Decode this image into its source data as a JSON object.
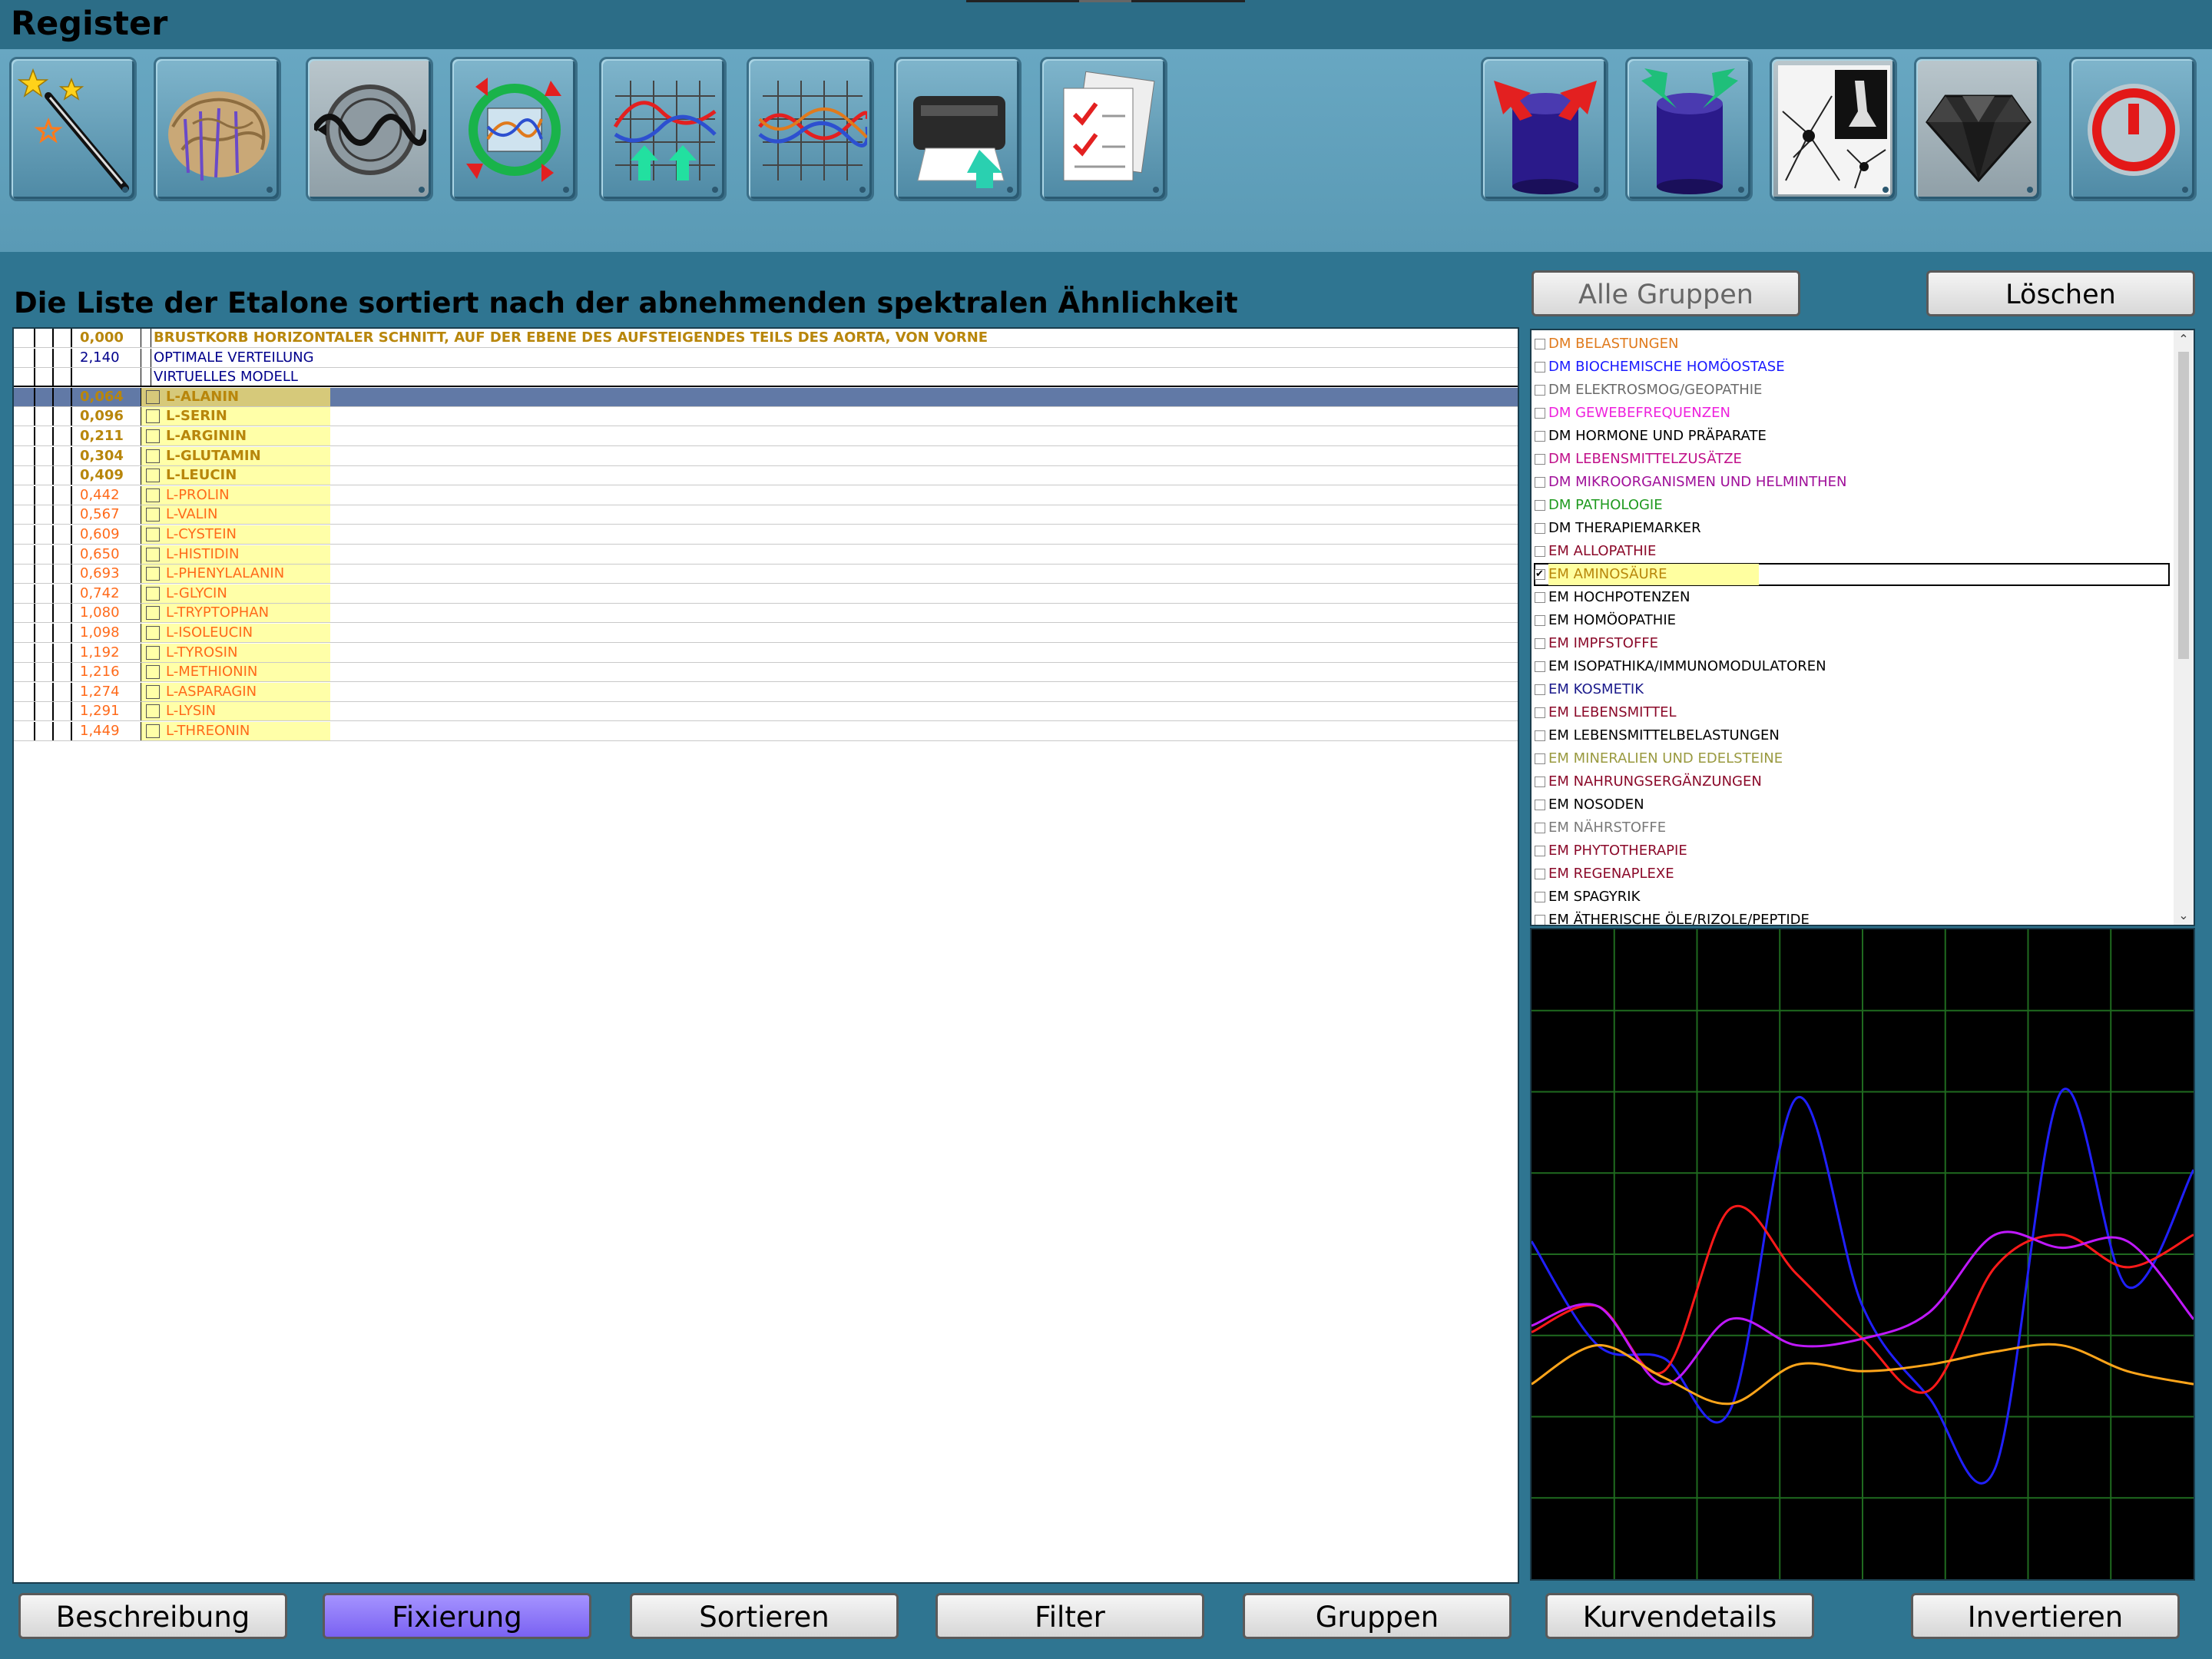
{
  "window": {
    "title": "Register"
  },
  "toolbar": {
    "left_buttons": [
      {
        "name": "magic-wand",
        "icon": "magic-wand-icon"
      },
      {
        "name": "brain",
        "icon": "brain-icon"
      },
      {
        "name": "wave-scan",
        "icon": "wave-scan-icon"
      },
      {
        "name": "cycle-compare",
        "icon": "cycle-compare-icon"
      },
      {
        "name": "graph-arrows",
        "icon": "graph-up-arrows-icon"
      },
      {
        "name": "multi-curve",
        "icon": "multi-curve-icon"
      },
      {
        "name": "printer",
        "icon": "printer-icon"
      },
      {
        "name": "checklist",
        "icon": "checklist-icon"
      }
    ],
    "right_buttons": [
      {
        "name": "bucket-in",
        "icon": "bucket-red-arrows-icon"
      },
      {
        "name": "bucket-out",
        "icon": "bucket-green-arrows-icon"
      },
      {
        "name": "microscope",
        "icon": "microscope-icon"
      },
      {
        "name": "gem",
        "icon": "gem-icon"
      },
      {
        "name": "power",
        "icon": "power-icon"
      }
    ]
  },
  "list": {
    "heading": "Die Liste der Etalone sortiert nach der abnehmenden spektralen Ähnlichkeit",
    "header_rows": [
      {
        "value": "0,000",
        "name": "BRUSTKORB HORIZONTALER SCHNITT, AUF DER EBENE DES AUFSTEIGENDES TEILS DES AORTA, VON VORNE"
      },
      {
        "value": "2,140",
        "name": "OPTIMALE VERTEILUNG"
      },
      {
        "value": "",
        "name": "VIRTUELLES MODELL"
      }
    ],
    "rows": [
      {
        "value": "0,064",
        "name": "L-ALANIN"
      },
      {
        "value": "0,096",
        "name": "L-SERIN"
      },
      {
        "value": "0,211",
        "name": "L-ARGININ"
      },
      {
        "value": "0,304",
        "name": "L-GLUTAMIN"
      },
      {
        "value": "0,409",
        "name": "L-LEUCIN"
      },
      {
        "value": "0,442",
        "name": "L-PROLIN"
      },
      {
        "value": "0,567",
        "name": "L-VALIN"
      },
      {
        "value": "0,609",
        "name": "L-CYSTEIN"
      },
      {
        "value": "0,650",
        "name": "L-HISTIDIN"
      },
      {
        "value": "0,693",
        "name": "L-PHENYLALANIN"
      },
      {
        "value": "0,742",
        "name": "L-GLYCIN"
      },
      {
        "value": "1,080",
        "name": "L-TRYPTOPHAN"
      },
      {
        "value": "1,098",
        "name": "L-ISOLEUCIN"
      },
      {
        "value": "1,192",
        "name": "L-TYROSIN"
      },
      {
        "value": "1,216",
        "name": "L-METHIONIN"
      },
      {
        "value": "1,274",
        "name": "L-ASPARAGIN"
      },
      {
        "value": "1,291",
        "name": "L-LYSIN"
      },
      {
        "value": "1,449",
        "name": "L-THREONIN"
      }
    ]
  },
  "groups": {
    "all_button": "Alle Gruppen",
    "clear_button": "Löschen",
    "items": [
      {
        "label": "DM BELASTUNGEN",
        "color": "#e07a1c",
        "checked": false
      },
      {
        "label": "DM BIOCHEMISCHE HOMÖOSTASE",
        "color": "#1a1aff",
        "checked": false
      },
      {
        "label": "DM ELEKTROSMOG/GEOPATHIE",
        "color": "#6b6b6b",
        "checked": false
      },
      {
        "label": "DM GEWEBEFREQUENZEN",
        "color": "#ee22dd",
        "checked": false
      },
      {
        "label": "DM HORMONE UND PRÄPARATE",
        "color": "#000000",
        "checked": false
      },
      {
        "label": "DM LEBENSMITTELZUSÄTZE",
        "color": "#c0108a",
        "checked": false
      },
      {
        "label": "DM MIKROORGANISMEN UND HELMINTHEN",
        "color": "#a0109a",
        "checked": false
      },
      {
        "label": "DM PATHOLOGIE",
        "color": "#1f9a1f",
        "checked": false
      },
      {
        "label": "DM THERAPIEMARKER",
        "color": "#000000",
        "checked": false
      },
      {
        "label": "EM ALLOPATHIE",
        "color": "#8b0a2a",
        "checked": false
      },
      {
        "label": "EM AMINOSÄURE",
        "color": "#b8860b",
        "checked": true
      },
      {
        "label": "EM HOCHPOTENZEN",
        "color": "#000000",
        "checked": false
      },
      {
        "label": "EM HOMÖOPATHIE",
        "color": "#000000",
        "checked": false
      },
      {
        "label": "EM IMPFSTOFFE",
        "color": "#8b0a2a",
        "checked": false
      },
      {
        "label": "EM ISOPATHIKA/IMMUNOMODULATOREN",
        "color": "#000000",
        "checked": false
      },
      {
        "label": "EM KOSMETIK",
        "color": "#1a1a8b",
        "checked": false
      },
      {
        "label": "EM LEBENSMITTEL",
        "color": "#8b0a2a",
        "checked": false
      },
      {
        "label": "EM LEBENSMITTELBELASTUNGEN",
        "color": "#000000",
        "checked": false
      },
      {
        "label": "EM MINERALIEN UND EDELSTEINE",
        "color": "#9a9a40",
        "checked": false
      },
      {
        "label": "EM NAHRUNGSERGÄNZUNGEN",
        "color": "#8b0a2a",
        "checked": false
      },
      {
        "label": "EM NOSODEN",
        "color": "#000000",
        "checked": false
      },
      {
        "label": "EM NÄHRSTOFFE",
        "color": "#7a7a7a",
        "checked": false
      },
      {
        "label": "EM PHYTOTHERAPIE",
        "color": "#8b0a2a",
        "checked": false
      },
      {
        "label": "EM REGENAPLEXE",
        "color": "#8b0a2a",
        "checked": false
      },
      {
        "label": "EM SPAGYRIK",
        "color": "#000000",
        "checked": false
      },
      {
        "label": "EM ÄTHERISCHE ÖLE/RIZOLE/PEPTIDE",
        "color": "#000000",
        "checked": false
      }
    ]
  },
  "graph": {
    "grid_color": "#1f6a1f",
    "series": [
      {
        "color": "#2020ff",
        "values": [
          0.48,
          0.64,
          0.66,
          0.74,
          0.26,
          0.58,
          0.72,
          0.83,
          0.25,
          0.55,
          0.37
        ]
      },
      {
        "color": "#ff1a1a",
        "values": [
          0.62,
          0.58,
          0.68,
          0.43,
          0.53,
          0.63,
          0.71,
          0.52,
          0.47,
          0.52,
          0.47
        ]
      },
      {
        "color": "#c018ff",
        "values": [
          0.61,
          0.58,
          0.7,
          0.6,
          0.64,
          0.63,
          0.59,
          0.47,
          0.49,
          0.48,
          0.6
        ]
      },
      {
        "color": "#ffa51a",
        "values": [
          0.7,
          0.64,
          0.69,
          0.73,
          0.67,
          0.68,
          0.67,
          0.65,
          0.64,
          0.68,
          0.7
        ]
      }
    ]
  },
  "bottom_buttons": {
    "beschreibung": "Beschreibung",
    "fixierung": "Fixierung",
    "sortieren": "Sortieren",
    "filter": "Filter",
    "gruppen": "Gruppen",
    "kurvendetails": "Kurvendetails",
    "invertieren": "Invertieren"
  }
}
